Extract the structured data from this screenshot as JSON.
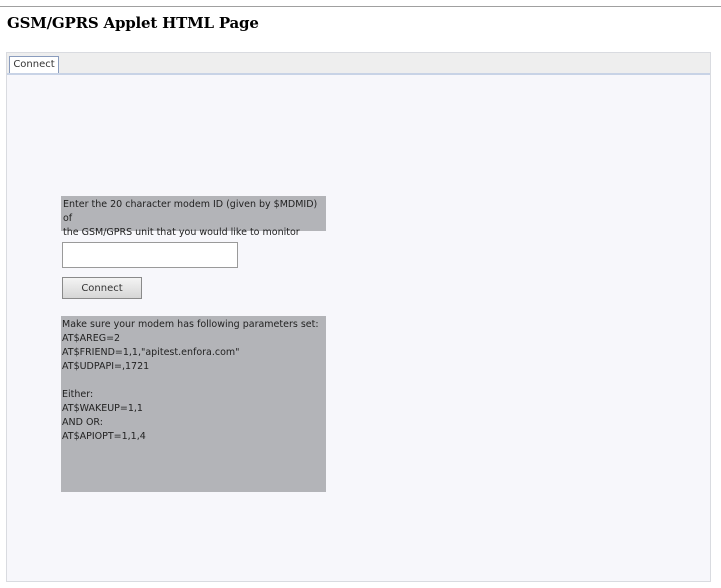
{
  "page": {
    "title": "GSM/GPRS Applet HTML Page"
  },
  "applet": {
    "tabs": [
      {
        "label": "Connect",
        "selected": true
      }
    ],
    "instructions": "Enter the 20 character modem ID (given by $MDMID) of\nthe GSM/GPRS unit that you would like to monitor",
    "modem_id_input": {
      "value": "",
      "placeholder": ""
    },
    "connect_button_label": "Connect",
    "params": {
      "lines": [
        "Make sure your modem has following parameters set:",
        "AT$AREG=2",
        "AT$FRIEND=1,1,\"apitest.enfora.com\"",
        "AT$UDPAPI=,1721",
        "",
        "Either:",
        "AT$WAKEUP=1,1",
        "AND OR:",
        "AT$APIOPT=1,1,4"
      ]
    }
  },
  "colors": {
    "panel_gray": "#b3b4b8",
    "applet_bg": "#f7f7fb",
    "tab_border_blue": "#6d86b3"
  }
}
